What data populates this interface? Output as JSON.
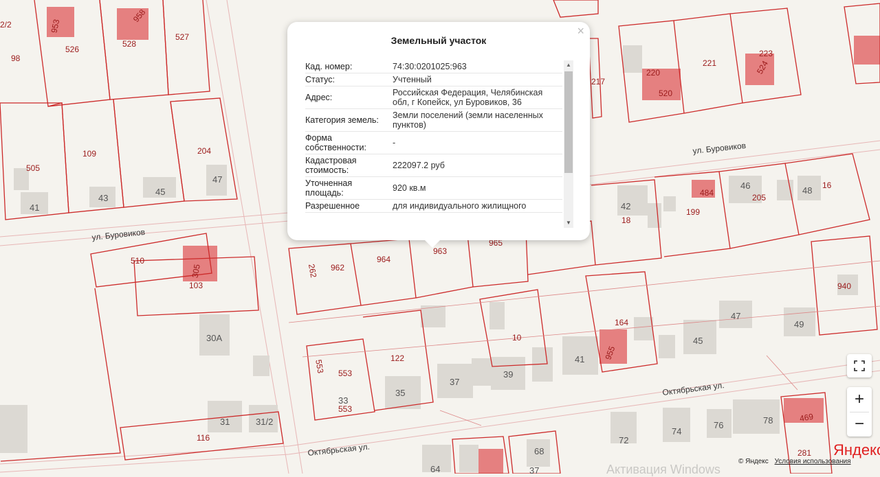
{
  "popup": {
    "title": "Земельный участок",
    "close_label": "×",
    "rows": [
      {
        "key": "Кад. номер:",
        "value": "74:30:0201025:963"
      },
      {
        "key": "Статус:",
        "value": "Учтенный"
      },
      {
        "key": "Адрес:",
        "value": "Российская Федерация, Челябинская обл, г Копейск, ул Буровиков, 36"
      },
      {
        "key": "Категория земель:",
        "value": "Земли поселений (земли населенных пунктов)"
      },
      {
        "key": "Форма собственности:",
        "value": "-"
      },
      {
        "key": "Кадастровая стоимость:",
        "value": "222097.2 руб"
      },
      {
        "key": "Уточненная площадь:",
        "value": "920 кв.м"
      },
      {
        "key": "Разрешенное",
        "value": "для индивидуального жилищного"
      }
    ],
    "scroll_up_icon": "triangle-up-icon",
    "scroll_down_icon": "triangle-down-icon"
  },
  "map": {
    "parcel_labels": [
      "2/2",
      "953",
      "958",
      "526",
      "528",
      "527",
      "98",
      "109",
      "505",
      "204",
      "510",
      "305",
      "103",
      "962",
      "964",
      "963",
      "965",
      "217",
      "220",
      "520",
      "221",
      "223",
      "524",
      "199",
      "484",
      "205",
      "16",
      "18",
      "940",
      "164",
      "955",
      "10",
      "122",
      "553",
      "553",
      "553",
      "116",
      "281",
      "469",
      "262"
    ],
    "house_numbers": [
      "41",
      "43",
      "45",
      "47",
      "30А",
      "31",
      "31/2",
      "33",
      "35",
      "37",
      "39",
      "41",
      "42",
      "46",
      "48",
      "47",
      "49",
      "45",
      "72",
      "74",
      "76",
      "78",
      "64",
      "68",
      "37"
    ],
    "streets": [
      "ул. Буровиков",
      "ул. Буровиков",
      "Октябрьская ул.",
      "Октябрьская ул."
    ]
  },
  "controls": {
    "fullscreen_icon": "fullscreen-icon",
    "zoom_in_label": "+",
    "zoom_out_label": "−"
  },
  "branding": {
    "logo": "Яндекс",
    "copyright": "© Яндекс",
    "terms_link": "Условия использования",
    "watermark": "Активация Windows"
  },
  "colors": {
    "parcel_border": "#cc2a2a",
    "parcel_fill": "#e58080",
    "building": "#d9d6d0"
  }
}
